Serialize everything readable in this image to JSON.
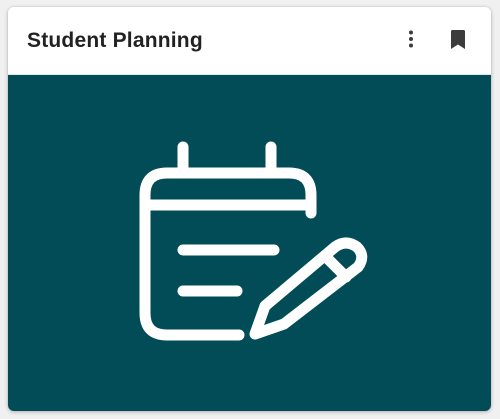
{
  "card": {
    "title": "Student Planning",
    "menu_icon": "more-vert-icon",
    "bookmark_icon": "bookmark-icon",
    "illustration_icon": "planner-notepad-pencil-icon"
  },
  "colors": {
    "page_background": "#f0f0f0",
    "card_background": "#ffffff",
    "body_background": "#024c57",
    "icon_stroke": "#ffffff",
    "title_text": "#222222",
    "header_icon": "#3c3c3c"
  }
}
